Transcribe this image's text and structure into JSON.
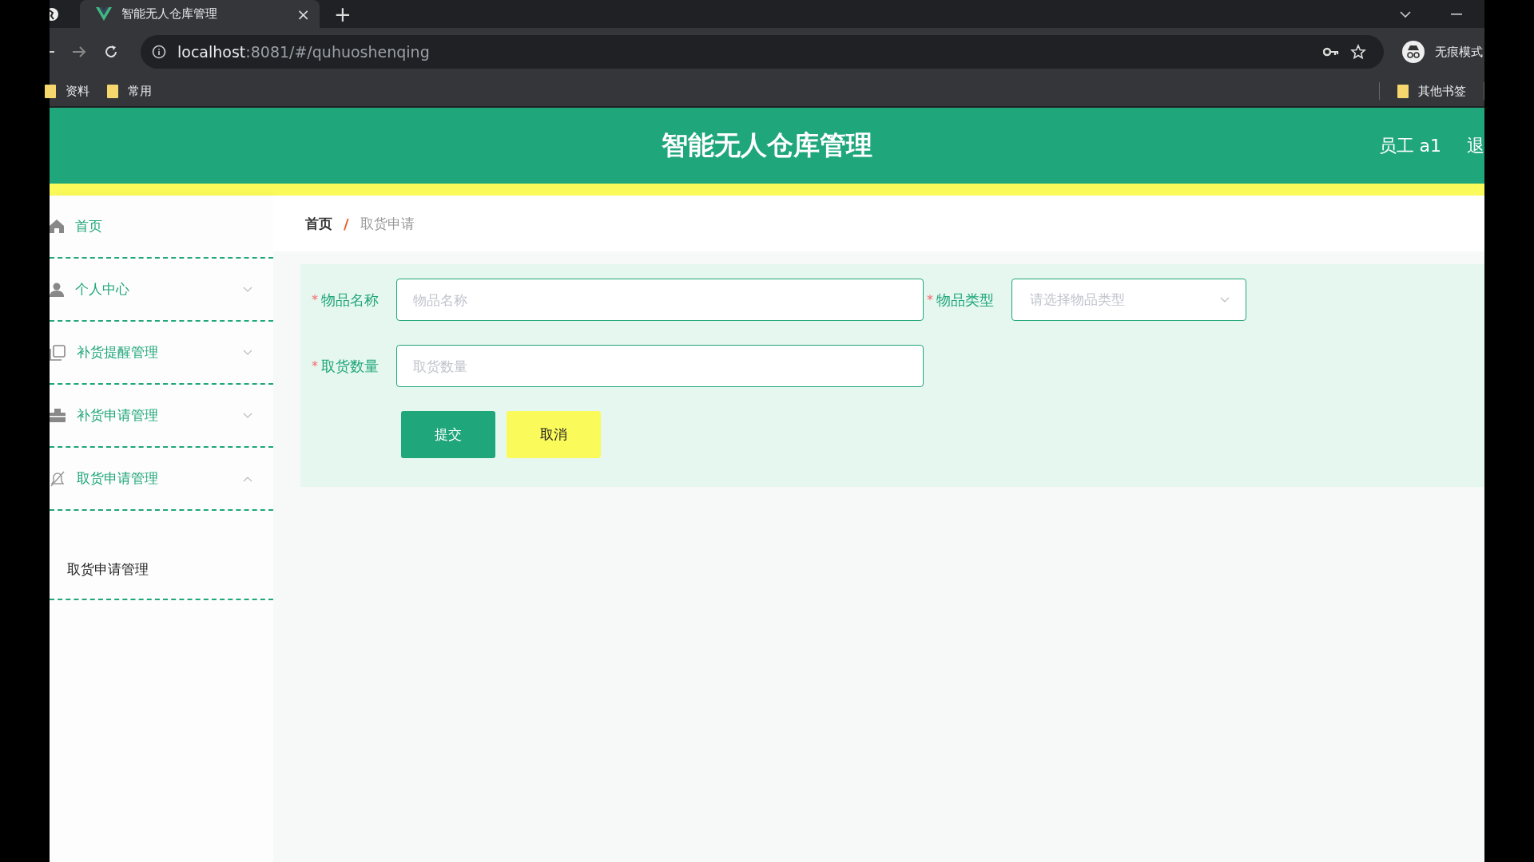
{
  "browser": {
    "tab": {
      "title": "智能无人仓库管理",
      "close": "×"
    },
    "new_tab": "+",
    "url": {
      "host": "localhost",
      "rest": ":8081/#/quhuoshenqing"
    },
    "profile": "无痕模式",
    "bookmarks": [
      "资料",
      "常用"
    ],
    "other_bookmarks": "其他书签"
  },
  "header": {
    "title": "智能无人仓库管理",
    "user": "员工 a1",
    "logout": "退"
  },
  "sidebar": {
    "items": [
      {
        "label": "首页",
        "kind": "link"
      },
      {
        "label": "个人中心",
        "kind": "group",
        "expanded": false
      },
      {
        "label": "补货提醒管理",
        "kind": "group",
        "expanded": false
      },
      {
        "label": "补货申请管理",
        "kind": "group",
        "expanded": false
      },
      {
        "label": "取货申请管理",
        "kind": "group",
        "expanded": true,
        "children": [
          {
            "label": "取货申请管理"
          }
        ]
      }
    ]
  },
  "breadcrumb": [
    "首页",
    "取货申请"
  ],
  "breadcrumb_separator": "/",
  "form": {
    "rows": [
      [
        {
          "label": "物品名称",
          "required_mark": "*",
          "kind": "input",
          "placeholder": "物品名称"
        },
        {
          "label": "物品类型",
          "required_mark": "*",
          "kind": "select",
          "placeholder": "请选择物品类型"
        }
      ],
      [
        {
          "label": "取货数量",
          "required_mark": "*",
          "kind": "input",
          "placeholder": "取货数量"
        }
      ]
    ],
    "buttons": [
      {
        "label": "提交",
        "kind": "primary"
      },
      {
        "label": "取消",
        "kind": "secondary"
      }
    ]
  }
}
